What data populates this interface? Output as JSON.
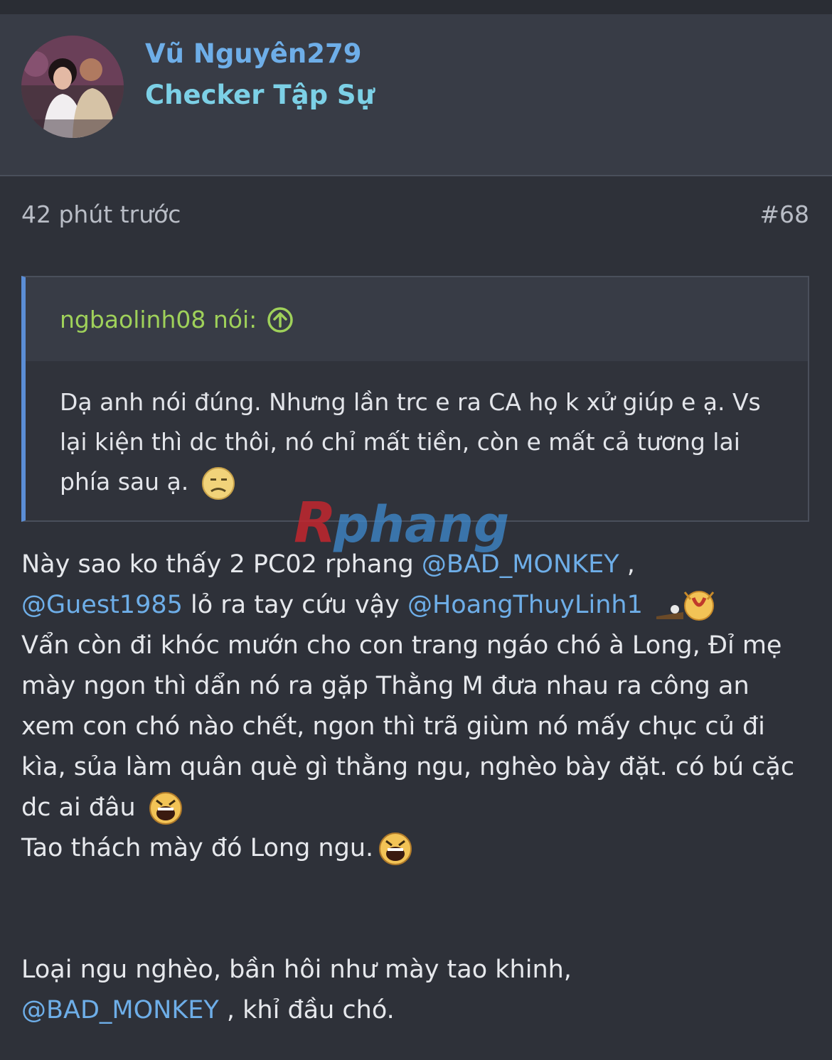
{
  "user": {
    "name": "Vũ Nguyên279",
    "title": "Checker Tập Sự",
    "avatar_icon": "avatar-photo"
  },
  "post_meta": {
    "time": "42 phút trước",
    "number": "#68"
  },
  "quote": {
    "author": "ngbaolinh08 nói:",
    "arrow_icon": "arrow-up-circle-icon",
    "body": "Dạ anh nói đúng. Nhưng lần trc e ra CA họ k xử giúp e ạ. Vs lại kiện thì dc thôi, nó chỉ mất tiền, còn e mất cả tương lai phía sau ạ.",
    "emoji": "sad-smiley-icon"
  },
  "watermark": {
    "text": "Rphang"
  },
  "message": {
    "line1_text": "Này sao ko thấy 2 PC02 rphang ",
    "mention1": "@BAD_MONKEY",
    "line1_sep": " ,",
    "mention2": "@Guest1985",
    "line2_text": " lỏ ra tay cứu vậy ",
    "mention3": "@HoangThuyLinh1",
    "para2": "Vẩn còn đi khóc mướn cho con trang ngáo chó à Long, Đỉ mẹ mày ngon thì dẩn nó ra gặp Thằng M đưa nhau ra công an xem con chó nào chết, ngon thì trã giùm nó mấy chục củ đi kìa, sủa làm quân què gì thằng ngu, nghèo bày đặt. có bú cặc dc ai đâu",
    "para3": "Tao thách mày đó Long ngu.",
    "para4": "Loại ngu nghèo, bần hôi như mày tao khinh,",
    "mention4": "@BAD_MONKEY",
    "para4_end": " , khỉ đầu chó."
  },
  "colors": {
    "background": "#2e3139",
    "card": "#383c46",
    "username": "#6eaee8",
    "title": "#7cd0e6",
    "quote_author": "#9fd15a",
    "quote_border": "#5b8ed6",
    "mention": "#6eaee8"
  }
}
